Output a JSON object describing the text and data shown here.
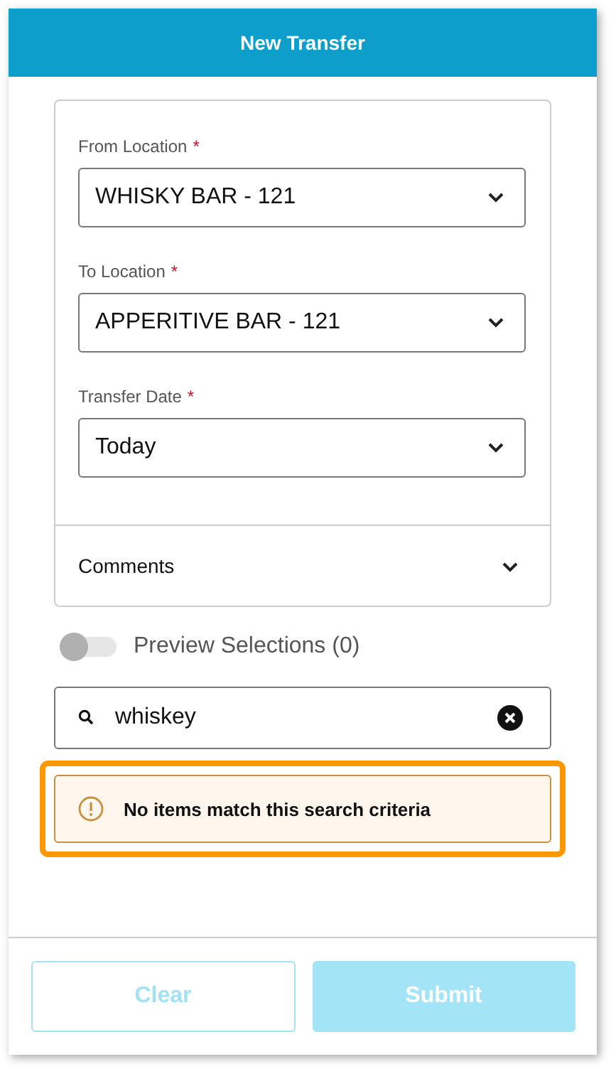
{
  "header": {
    "title": "New Transfer"
  },
  "fields": [
    {
      "kind": "select",
      "label": "From Location",
      "required_mark": "*",
      "value": "WHISKY BAR - 121"
    },
    {
      "kind": "select",
      "label": "To Location",
      "required_mark": "*",
      "value": "APPERITIVE BAR - 121"
    },
    {
      "kind": "select",
      "label": "Transfer Date",
      "required_mark": "*",
      "value": "Today"
    }
  ],
  "comments": {
    "label": "Comments",
    "expanded": false
  },
  "preview_toggle": {
    "label": "Preview Selections (0)",
    "on": false
  },
  "search": {
    "value": "whiskey"
  },
  "alert": {
    "text": "No items match this search criteria",
    "highlighted": true
  },
  "buttons": [
    {
      "kind": "outline",
      "label": "Clear",
      "disabled": true
    },
    {
      "kind": "primary",
      "label": "Submit",
      "disabled": true
    }
  ]
}
